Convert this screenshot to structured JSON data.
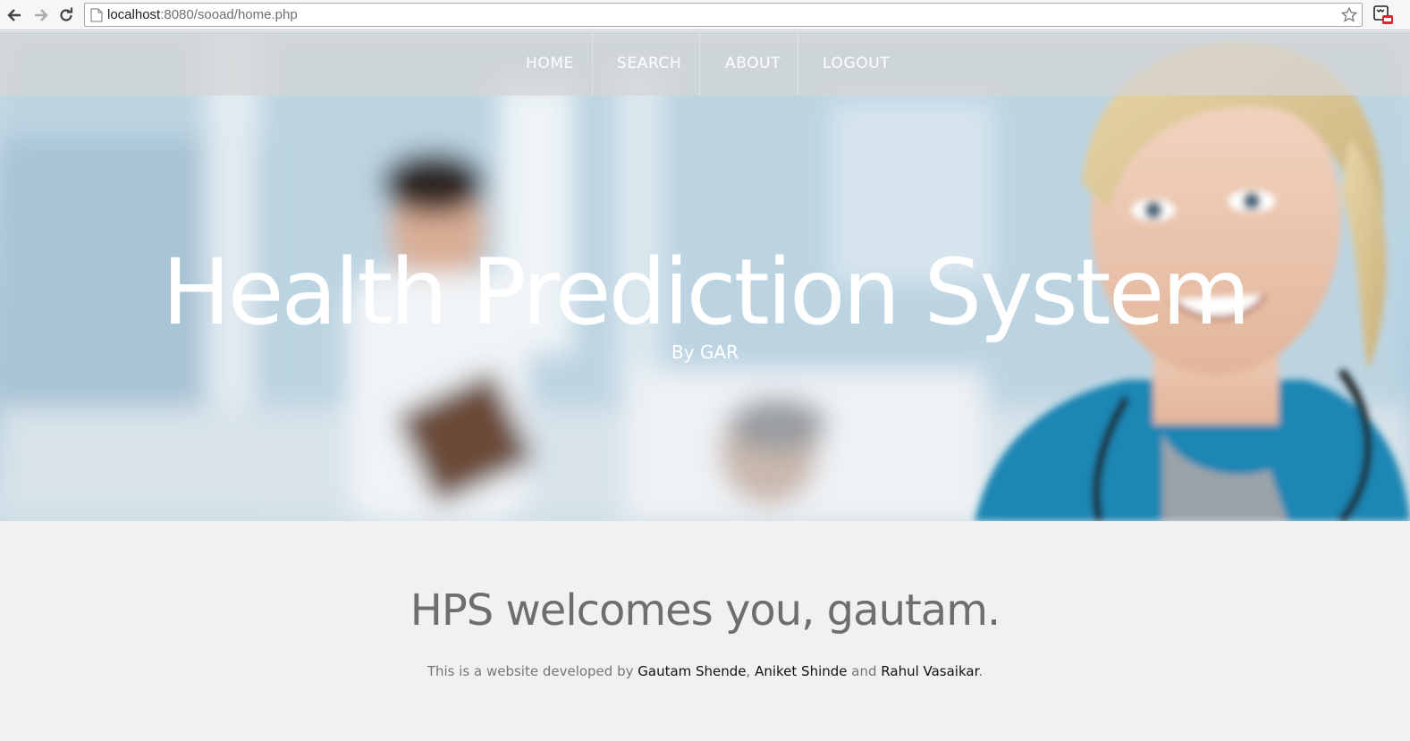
{
  "browser": {
    "url_host": "localhost",
    "url_rest": ":8080/sooad/home.php",
    "icons": [
      "back-arrow-icon",
      "forward-arrow-icon",
      "reload-icon",
      "page-icon",
      "bookmark-star-icon",
      "extension-icon"
    ]
  },
  "nav": {
    "items": [
      {
        "label": "HOME"
      },
      {
        "label": "SEARCH"
      },
      {
        "label": "ABOUT"
      },
      {
        "label": "LOGOUT"
      }
    ]
  },
  "hero": {
    "title": "Health Prediction System",
    "subtitle": "By GAR"
  },
  "main": {
    "welcome": "HPS welcomes you, gautam.",
    "credit_prefix": "This is a website developed by ",
    "author1": "Gautam Shende",
    "sep1": ", ",
    "author2": "Aniket Shinde",
    "sep2": " and ",
    "author3": "Rahul Vasaikar",
    "credit_suffix": "."
  },
  "colors": {
    "nav_text": "#ffffff",
    "welcome_text": "#6e6e6e",
    "page_bg": "#f1f1f1",
    "scrub_blue": "#1e86b4"
  }
}
